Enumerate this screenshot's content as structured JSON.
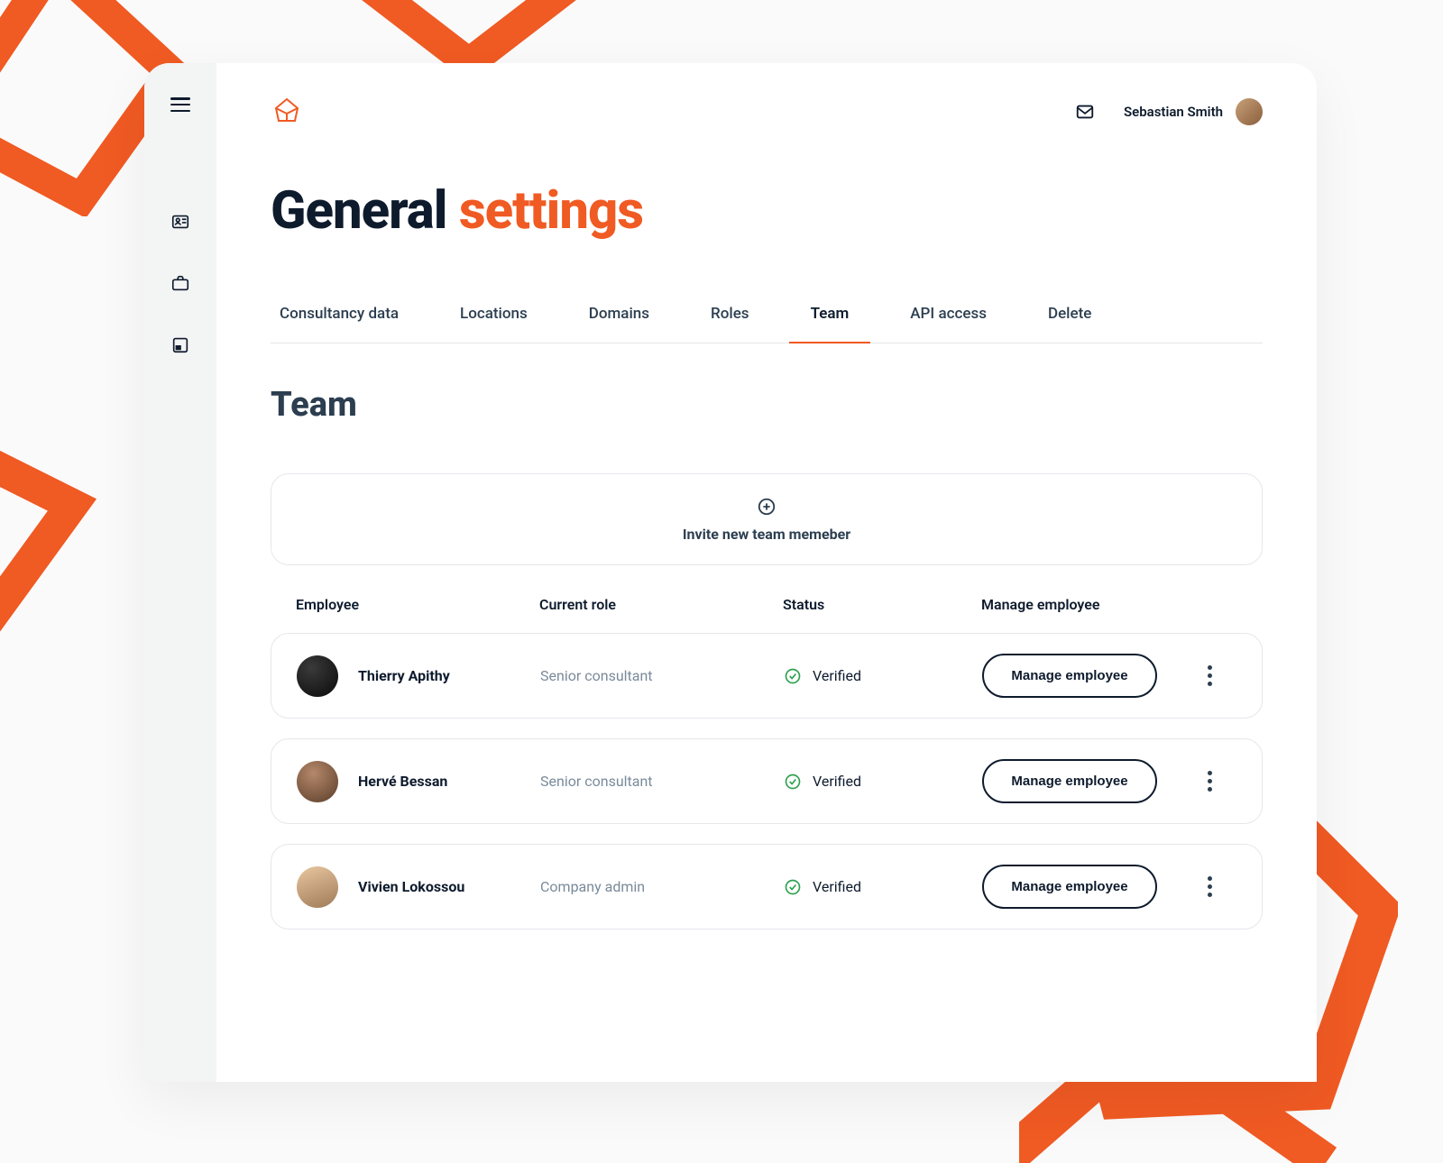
{
  "header": {
    "user_name": "Sebastian Smith"
  },
  "page": {
    "title_1": "General ",
    "title_2": "settings"
  },
  "tabs": [
    {
      "label": "Consultancy data",
      "active": false
    },
    {
      "label": "Locations",
      "active": false
    },
    {
      "label": "Domains",
      "active": false
    },
    {
      "label": "Roles",
      "active": false
    },
    {
      "label": "Team",
      "active": true
    },
    {
      "label": "API access",
      "active": false
    },
    {
      "label": "Delete",
      "active": false
    }
  ],
  "section": {
    "title": "Team",
    "invite_label": "Invite new team memeber"
  },
  "table": {
    "headers": {
      "employee": "Employee",
      "role": "Current role",
      "status": "Status",
      "manage": "Manage employee"
    },
    "manage_button": "Manage employee",
    "verified_label": "Verified",
    "rows": [
      {
        "name": "Thierry Apithy",
        "role": "Senior consultant",
        "status": "Verified"
      },
      {
        "name": "Hervé Bessan",
        "role": "Senior consultant",
        "status": "Verified"
      },
      {
        "name": "Vivien Lokossou",
        "role": "Company admin",
        "status": "Verified"
      }
    ]
  }
}
